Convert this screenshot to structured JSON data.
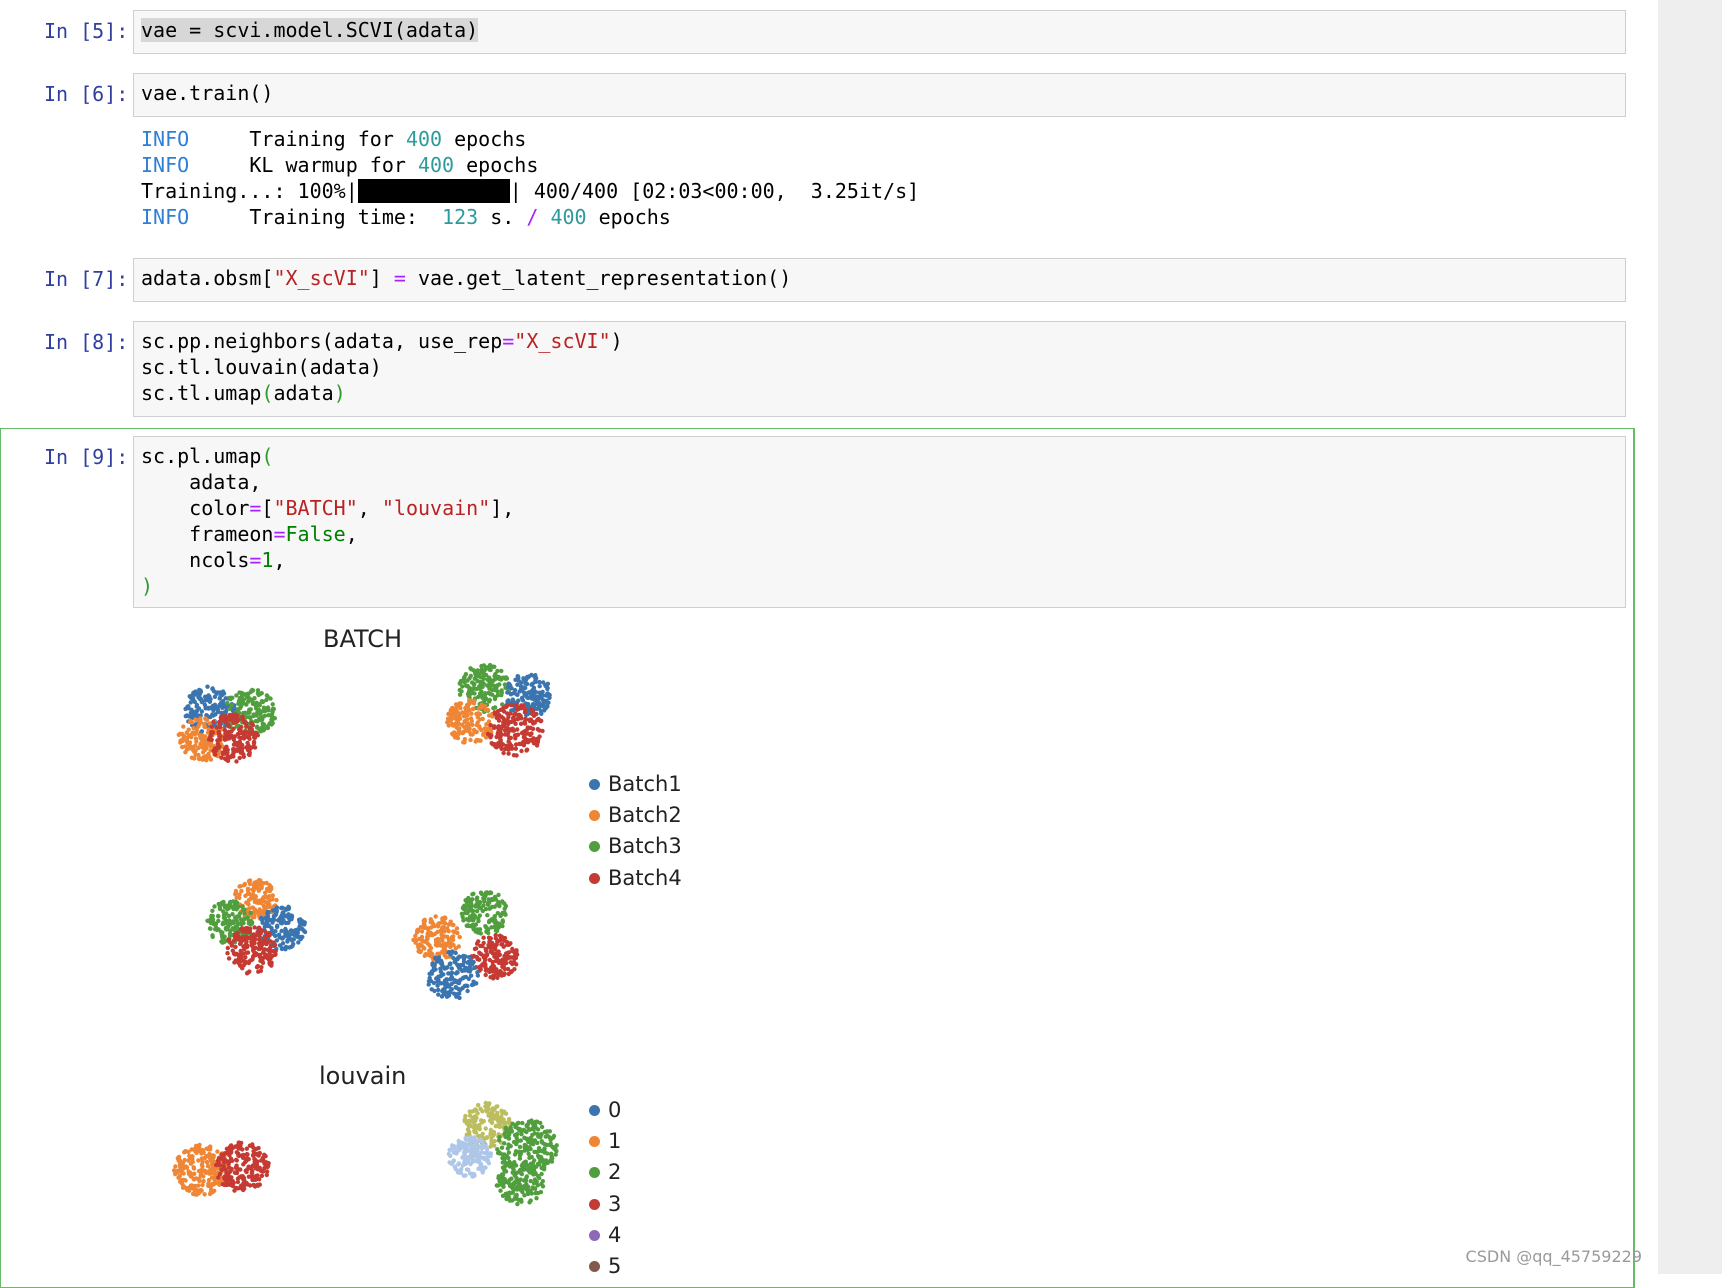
{
  "cells": [
    {
      "prompt": "In [5]:"
    },
    {
      "prompt": "In [6]:"
    },
    {
      "prompt": "In [7]:"
    },
    {
      "prompt": "In [8]:"
    },
    {
      "prompt": "In [9]:"
    }
  ],
  "cell5": {
    "code": "vae = scvi.model.SCVI(adata)"
  },
  "cell6": {
    "code": "vae.train()",
    "output": {
      "line1": {
        "level": "INFO",
        "text": "Training for ",
        "num": "400",
        "tail": " epochs"
      },
      "line2": {
        "level": "INFO",
        "text": "KL warmup for ",
        "num": "400",
        "tail": " epochs"
      },
      "line3": {
        "prefix": "Training...: 100%|",
        "suffix": "| 400/400 [02:03<00:00,  3.25it/s]",
        "progress": 1.0
      },
      "line4": {
        "level": "INFO",
        "text": "Training time:  ",
        "num": "123",
        "mid": " s. ",
        "slash": "/",
        "num2": "400",
        "tail": " epochs"
      }
    }
  },
  "cell7": {
    "pre": "adata.obsm[",
    "str": "\"X_scVI\"",
    "mid": "] ",
    "eq": "=",
    "post": " vae.get_latent_representation()"
  },
  "cell8": {
    "line1_pre": "sc.pp.neighbors(adata, use_rep",
    "line1_eq": "=",
    "line1_str": "\"X_scVI\"",
    "line1_post": ")",
    "line2": "sc.tl.louvain(adata)",
    "line3_pre": "sc.tl.umap",
    "line3_open": "(",
    "line3_mid": "adata",
    "line3_close": ")"
  },
  "cell9": {
    "l1_pre": "sc.pl.umap",
    "l1_paren": "(",
    "l2": "    adata,",
    "l3_pre": "    color",
    "l3_eq": "=",
    "l3_open": "[",
    "l3_s1": "\"BATCH\"",
    "l3_comma": ", ",
    "l3_s2": "\"louvain\"",
    "l3_close": "],",
    "l4_pre": "    frameon",
    "l4_eq": "=",
    "l4_kw": "False",
    "l4_tail": ",",
    "l5_pre": "    ncols",
    "l5_eq": "=",
    "l5_num": "1",
    "l5_tail": ",",
    "l6": ")"
  },
  "plot_batch": {
    "title": "BATCH",
    "legend": [
      {
        "label": "Batch1",
        "color": "#3b75af"
      },
      {
        "label": "Batch2",
        "color": "#ef8636"
      },
      {
        "label": "Batch3",
        "color": "#519e3e"
      },
      {
        "label": "Batch4",
        "color": "#c53a32"
      }
    ]
  },
  "plot_louvain": {
    "title": "louvain",
    "legend": [
      {
        "label": "0",
        "color": "#3b75af"
      },
      {
        "label": "1",
        "color": "#ef8636"
      },
      {
        "label": "2",
        "color": "#519e3e"
      },
      {
        "label": "3",
        "color": "#c53a32"
      },
      {
        "label": "4",
        "color": "#8d69b8"
      },
      {
        "label": "5",
        "color": "#84584e"
      }
    ],
    "extra_colors": {
      "olive": "#bcbd5e",
      "lightblue": "#aec7e8"
    }
  },
  "watermark": "CSDN @qq_45759229"
}
